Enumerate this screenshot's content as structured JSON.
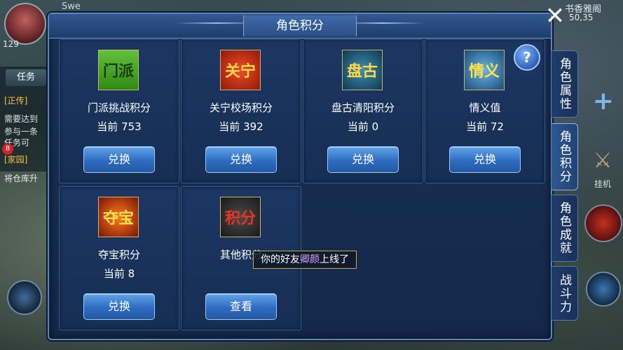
{
  "hud": {
    "top_left_name": "Swe",
    "top_right_place": "书香雅阁",
    "coords": "50,35",
    "level": "129",
    "task_tab": "任务",
    "quest_lines": [
      "[正传]",
      "需要达到",
      "参与一条",
      "任务可",
      "[家园]",
      "将仓库升"
    ],
    "badge_count": "8",
    "right_label": "挂机"
  },
  "panel": {
    "title": "角色积分",
    "close": "✕",
    "help": "?"
  },
  "cards": [
    {
      "emblem": "门派",
      "name": "门派挑战积分",
      "current": "当前 753",
      "button": "兑换"
    },
    {
      "emblem": "关宁",
      "name": "关宁校场积分",
      "current": "当前 392",
      "button": "兑换"
    },
    {
      "emblem": "盘古",
      "name": "盘古清阳积分",
      "current": "当前 0",
      "button": "兑换"
    },
    {
      "emblem": "情义",
      "name": "情义值",
      "current": "当前 72",
      "button": "兑换"
    },
    {
      "emblem": "夺宝",
      "name": "夺宝积分",
      "current": "当前 8",
      "button": "兑换"
    },
    {
      "emblem": "积分",
      "name": "其他积分",
      "current": "",
      "button": "查看"
    }
  ],
  "side_tabs": [
    "角色属性",
    "角色积分",
    "角色成就",
    "战斗力"
  ],
  "toast": {
    "prefix": "你的好友",
    "friend": "卿颜",
    "suffix": "上线了"
  }
}
